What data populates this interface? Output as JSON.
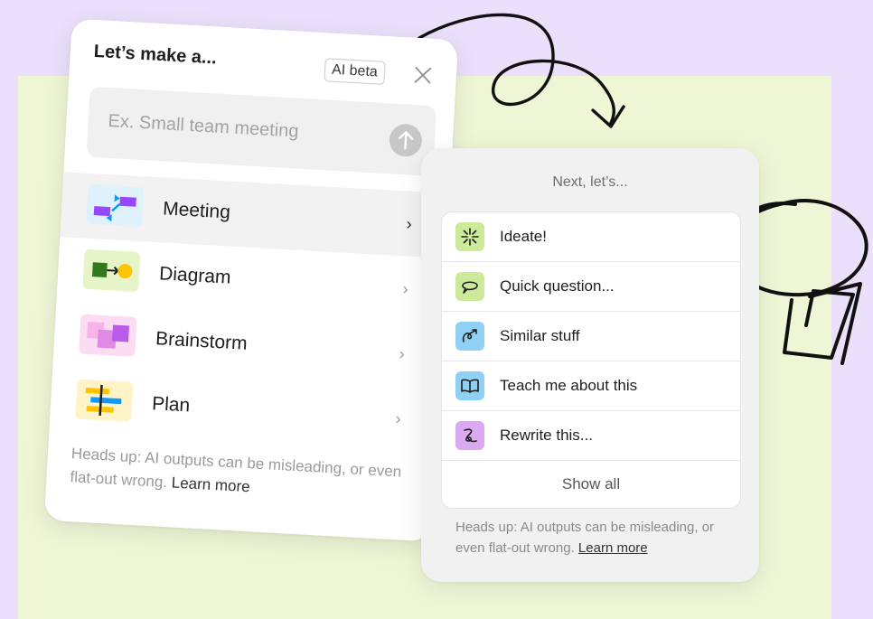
{
  "left_card": {
    "title": "Let’s make a...",
    "badge": "AI beta",
    "input_placeholder": "Ex. Small team meeting",
    "items": [
      {
        "label": "Meeting",
        "thumb_color": "#dff1fb"
      },
      {
        "label": "Diagram",
        "thumb_color": "#e6f4c8"
      },
      {
        "label": "Brainstorm",
        "thumb_color": "#fbdcf2"
      },
      {
        "label": "Plan",
        "thumb_color": "#fff4c7"
      }
    ],
    "footer_text": "Heads up: AI outputs can be misleading, or even flat-out wrong.",
    "footer_link": "Learn more"
  },
  "right_card": {
    "title": "Next, let’s...",
    "items": [
      {
        "label": "Ideate!",
        "icon": "sparkle-icon",
        "color": "#cdea9b"
      },
      {
        "label": "Quick question...",
        "icon": "speech-bubble-icon",
        "color": "#cdea9b"
      },
      {
        "label": "Similar stuff",
        "icon": "swirl-arrow-icon",
        "color": "#8fd0f5"
      },
      {
        "label": "Teach me about this",
        "icon": "open-book-icon",
        "color": "#8fd0f5"
      },
      {
        "label": "Rewrite this...",
        "icon": "scribble-icon",
        "color": "#d9a9f2"
      }
    ],
    "show_all": "Show all",
    "footer_text": "Heads up: AI outputs can be misleading, or even flat-out wrong.",
    "footer_link": "Learn more"
  },
  "colors": {
    "page_background": "#ebe0fb",
    "canvas_background": "#eef6d6",
    "accent_purple": "#9747ff",
    "accent_blue": "#0d99ff"
  }
}
